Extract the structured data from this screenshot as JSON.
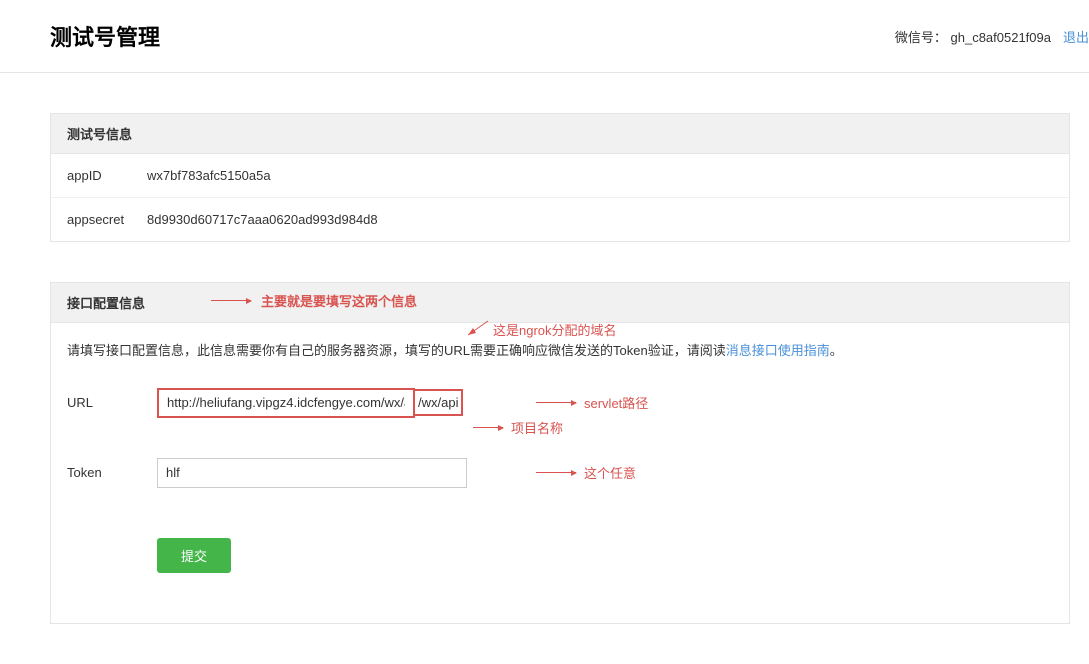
{
  "header": {
    "title": "测试号管理",
    "wechat_label": "微信号：",
    "wechat_id": "gh_c8af0521f09a",
    "logout": "退出"
  },
  "testInfo": {
    "section_title": "测试号信息",
    "appid_label": "appID",
    "appid_value": "wx7bf783afc5150a5a",
    "appsecret_label": "appsecret",
    "appsecret_value": "8d9930d60717c7aaa0620ad993d984d8"
  },
  "apiConfig": {
    "section_title": "接口配置信息",
    "desc_prefix": "请填写接口配置信息，此信息需要你有自己的服务器资源，填写的URL需要正确响应微信发送的Token验证，请阅读",
    "doc_link": "消息接口使用指南",
    "desc_suffix": "。",
    "url_label": "URL",
    "url_value": "http://heliufang.vipgz4.idcfengye.com/wx/api",
    "token_label": "Token",
    "token_value": "hlf",
    "submit_label": "提交"
  },
  "annotations": {
    "header_note": "主要就是要填写这两个信息",
    "ngrok_note": "这是ngrok分配的域名",
    "servlet_note": "servlet路径",
    "project_note": "项目名称",
    "token_note": "这个任意"
  }
}
